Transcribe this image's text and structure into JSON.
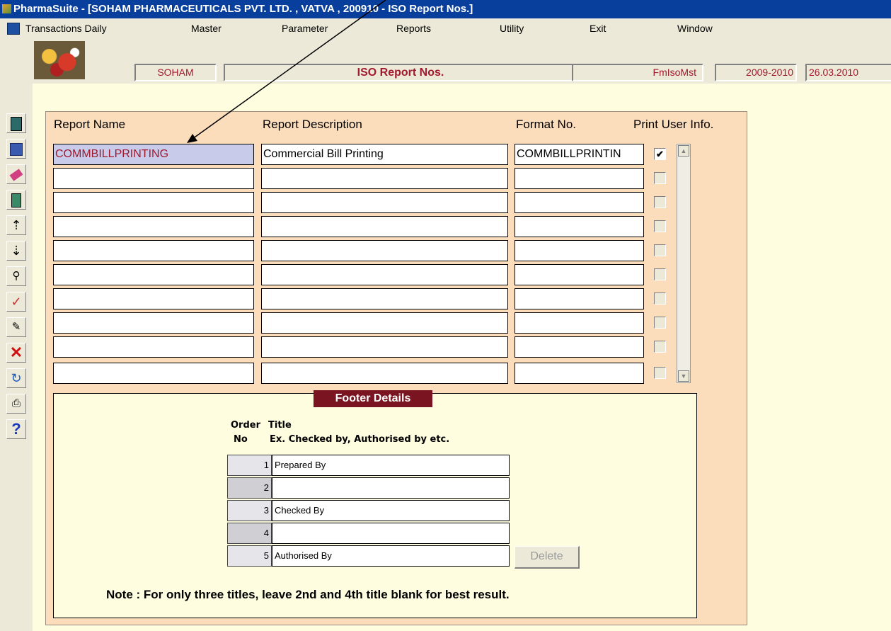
{
  "window": {
    "title": "PharmaSuite - [SOHAM PHARMACEUTICALS PVT. LTD. , VATVA , 200910 - ISO Report Nos.]"
  },
  "menu": {
    "items": [
      "Transactions Daily",
      "Master",
      "Parameter",
      "Reports",
      "Utility",
      "Exit",
      "Window"
    ]
  },
  "toolbar": {
    "company": "SOHAM",
    "screen_title": "ISO Report Nos.",
    "form_name": "FmIsoMst",
    "year": "2009-2010",
    "date": "26.03.2010"
  },
  "sidebar": {
    "icons": [
      "form-icon",
      "save-icon",
      "eraser-icon",
      "exit-door-icon",
      "arrow-up-icon",
      "arrow-down-icon",
      "binoculars-icon",
      "checkmark-icon",
      "pen-icon",
      "delete-x-icon",
      "refresh-icon",
      "print-icon",
      "help-icon"
    ]
  },
  "grid": {
    "headers": {
      "report_name": "Report Name",
      "report_description": "Report Description",
      "format_no": "Format No.",
      "print_user_info": "Print User Info."
    },
    "rows": [
      {
        "report_name": "COMMBILLPRINTING",
        "description": "Commercial Bill Printing",
        "format_no": "COMMBILLPRINTIN",
        "print_user_info": true
      },
      {
        "report_name": "",
        "description": "",
        "format_no": "",
        "print_user_info": false
      },
      {
        "report_name": "",
        "description": "",
        "format_no": "",
        "print_user_info": false
      },
      {
        "report_name": "",
        "description": "",
        "format_no": "",
        "print_user_info": false
      },
      {
        "report_name": "",
        "description": "",
        "format_no": "",
        "print_user_info": false
      },
      {
        "report_name": "",
        "description": "",
        "format_no": "",
        "print_user_info": false
      },
      {
        "report_name": "",
        "description": "",
        "format_no": "",
        "print_user_info": false
      },
      {
        "report_name": "",
        "description": "",
        "format_no": "",
        "print_user_info": false
      },
      {
        "report_name": "",
        "description": "",
        "format_no": "",
        "print_user_info": false
      },
      {
        "report_name": "",
        "description": "",
        "format_no": "",
        "print_user_info": false
      }
    ],
    "check_mark": "✔"
  },
  "footer": {
    "title": "Footer Details",
    "col_order": "Order",
    "col_no": "No",
    "col_title": "Title",
    "col_example": "Ex. Checked by, Authorised by etc.",
    "rows": [
      {
        "no": "1",
        "title": "Prepared By"
      },
      {
        "no": "2",
        "title": ""
      },
      {
        "no": "3",
        "title": "Checked By"
      },
      {
        "no": "4",
        "title": ""
      },
      {
        "no": "5",
        "title": "Authorised By"
      }
    ],
    "delete_label": "Delete",
    "note": "Note : For only three titles, leave 2nd and 4th title blank for best result."
  },
  "colors": {
    "titlebar": "#083e9c",
    "form_background": "#fbdcbb",
    "footer_title_bg": "#7a1420",
    "accent_text": "#a0192d"
  }
}
